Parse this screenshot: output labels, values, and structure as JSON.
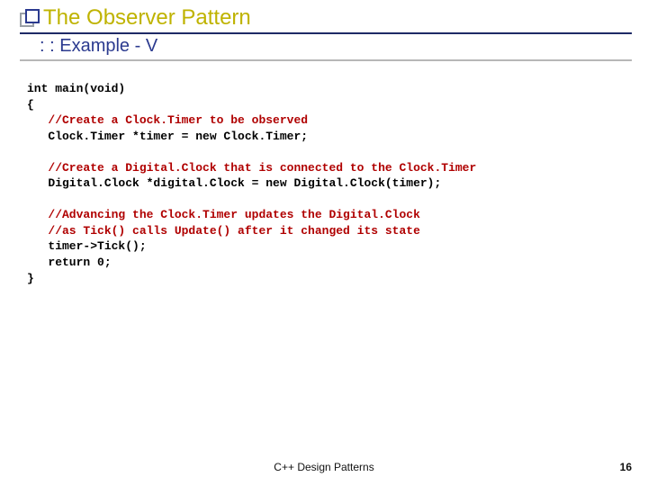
{
  "header": {
    "title": "The Observer Pattern",
    "subtitle": ": : Example - V"
  },
  "code": {
    "l1": "int main(void)",
    "l2": "{",
    "c1": "   //Create a Clock.Timer to be observed",
    "l3": "   Clock.Timer *timer = new Clock.Timer;",
    "c2": "   //Create a Digital.Clock that is connected to the Clock.Timer",
    "l4": "   Digital.Clock *digital.Clock = new Digital.Clock(timer);",
    "c3": "   //Advancing the Clock.Timer updates the Digital.Clock",
    "c4": "   //as Tick() calls Update() after it changed its state",
    "l5": "   timer->Tick();",
    "l6": "   return 0;",
    "l7": "}"
  },
  "footer": {
    "text": "C++ Design Patterns",
    "page": "16"
  }
}
